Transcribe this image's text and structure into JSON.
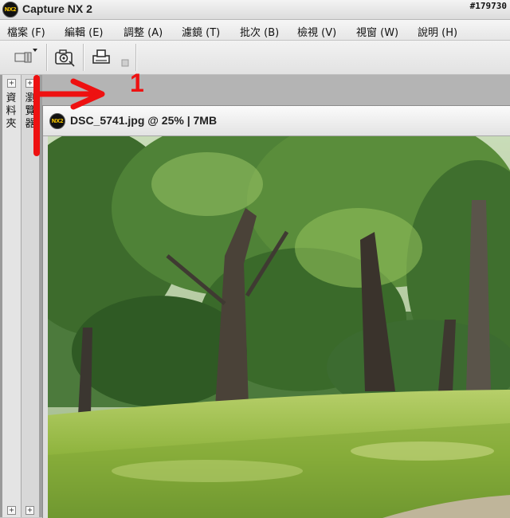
{
  "app": {
    "title": "Capture NX 2",
    "logo_text": "NX2",
    "watermark": "#179730"
  },
  "menu": {
    "items": [
      {
        "label": "檔案 (F)"
      },
      {
        "label": "編輯 (E)"
      },
      {
        "label": "調整 (A)"
      },
      {
        "label": "濾鏡 (T)"
      },
      {
        "label": "批次 (B)"
      },
      {
        "label": "檢視 (V)"
      },
      {
        "label": "視窗 (W)"
      },
      {
        "label": "說明 (H)"
      }
    ]
  },
  "toolbar": {
    "icons": [
      "film-strip-icon",
      "camera-icon",
      "print-icon",
      "corner-grip-icon"
    ]
  },
  "panels": {
    "folder_label": "資\n料\n夾",
    "browser_label": "瀏\n覽\n器",
    "expand_symbol": "+"
  },
  "document": {
    "title": "DSC_5741.jpg @ 25% | 7MB",
    "logo_text": "NX2",
    "image": "park-trees-photo"
  },
  "annotation": {
    "label": "1",
    "color": "#ee1111"
  },
  "colors": {
    "accent": "#f0c000",
    "annotation_red": "#ee1111"
  }
}
